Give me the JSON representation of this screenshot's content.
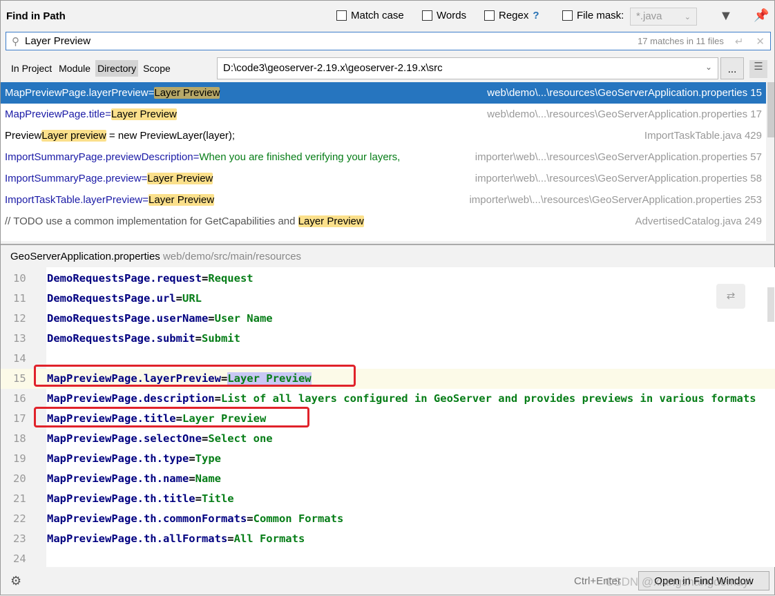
{
  "header": {
    "title": "Find in Path",
    "match_case": "Match case",
    "words": "Words",
    "regex": "Regex",
    "regex_help": "?",
    "file_mask": "File mask:",
    "file_mask_value": "*.java"
  },
  "search": {
    "value": "Layer Preview",
    "status": "17 matches in 11 files"
  },
  "scopes": [
    "In Project",
    "Module",
    "Directory",
    "Scope"
  ],
  "directory": "D:\\code3\\geoserver-2.19.x\\geoserver-2.19.x\\src",
  "results": [
    {
      "pre": "MapPreviewPage.layerPreview=",
      "hl": "Layer Preview",
      "post": "",
      "file": "web\\demo\\...\\resources\\GeoServerApplication.properties 15"
    },
    {
      "pre": "MapPreviewPage.title=",
      "hl": "Layer Preview",
      "post": "",
      "file": "web\\demo\\...\\resources\\GeoServerApplication.properties 17"
    },
    {
      "pre": "Preview",
      "hl": "Layer preview",
      "post": " = new PreviewLayer(layer);",
      "file": "ImportTaskTable.java 429"
    },
    {
      "pre": "ImportSummaryPage.previewDescription=",
      "hl": "",
      "post": "When you are finished verifying your layers,",
      "file": "importer\\web\\...\\resources\\GeoServerApplication.properties 57"
    },
    {
      "pre": "ImportSummaryPage.preview=",
      "hl": "Layer Preview",
      "post": "",
      "file": "importer\\web\\...\\resources\\GeoServerApplication.properties 58"
    },
    {
      "pre": "ImportTaskTable.layerPreview=",
      "hl": "Layer Preview",
      "post": "",
      "file": "importer\\web\\...\\resources\\GeoServerApplication.properties 253"
    },
    {
      "pre": "// TODO use a common implementation for GetCapabilities and ",
      "hl": "Layer Preview",
      "post": "",
      "file": "AdvertisedCatalog.java 249"
    }
  ],
  "preview": {
    "file": "GeoServerApplication.properties",
    "dir": "web/demo/src/main/resources"
  },
  "code": [
    {
      "n": "10",
      "k": "DemoRequestsPage.request",
      "v": "Request"
    },
    {
      "n": "11",
      "k": "DemoRequestsPage.url",
      "v": "URL"
    },
    {
      "n": "12",
      "k": "DemoRequestsPage.userName",
      "v": "User Name"
    },
    {
      "n": "13",
      "k": "DemoRequestsPage.submit",
      "v": "Submit"
    },
    {
      "n": "14",
      "k": "",
      "v": ""
    },
    {
      "n": "15",
      "k": "MapPreviewPage.layerPreview",
      "v": "Layer Preview"
    },
    {
      "n": "16",
      "k": "MapPreviewPage.description",
      "v": "List of all layers configured in GeoServer and provides previews in various formats"
    },
    {
      "n": "17",
      "k": "MapPreviewPage.title",
      "v": "Layer Preview"
    },
    {
      "n": "18",
      "k": "MapPreviewPage.selectOne",
      "v": "Select one"
    },
    {
      "n": "19",
      "k": "MapPreviewPage.th.type",
      "v": "Type"
    },
    {
      "n": "20",
      "k": "MapPreviewPage.th.name",
      "v": "Name"
    },
    {
      "n": "21",
      "k": "MapPreviewPage.th.title",
      "v": "Title"
    },
    {
      "n": "22",
      "k": "MapPreviewPage.th.commonFormats",
      "v": "Common Formats"
    },
    {
      "n": "23",
      "k": "MapPreviewPage.th.allFormats",
      "v": "All Formats"
    },
    {
      "n": "24",
      "k": "",
      "v": ""
    }
  ],
  "footer": {
    "shortcut": "Ctrl+Enter",
    "open_button": "Open in Find Window",
    "watermark": "CSDN @xiangshangdemayi"
  }
}
